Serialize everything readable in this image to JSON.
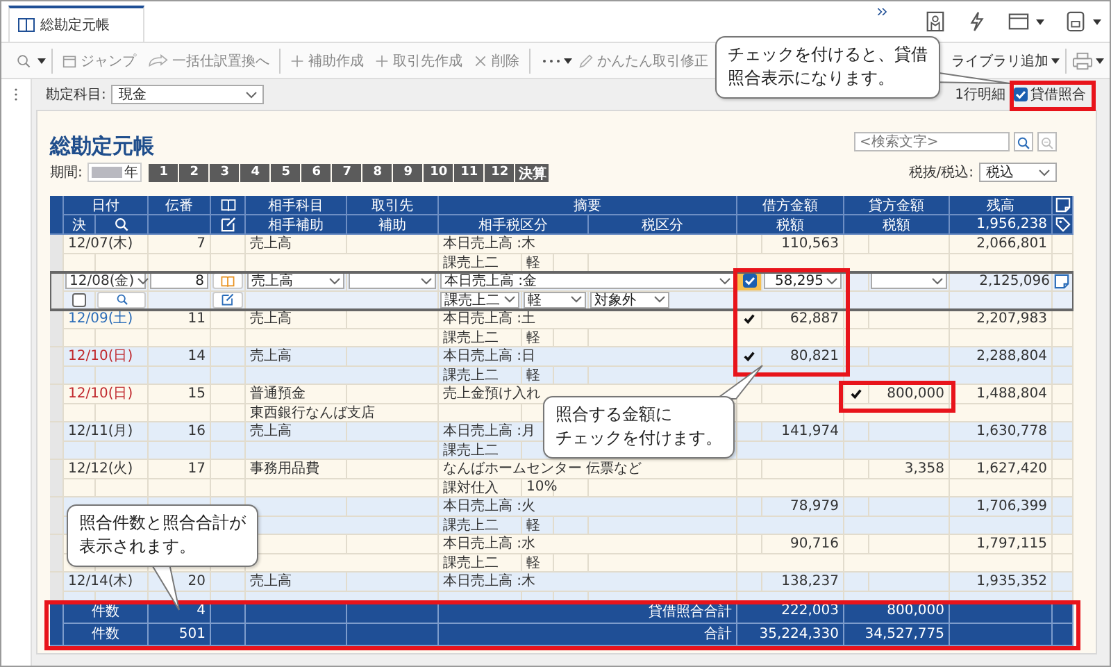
{
  "tabs": [
    {
      "label": "総勘定元帳",
      "selected": true
    }
  ],
  "toolbar": {
    "jump": "ジャンプ",
    "bulk_replace": "一括仕訳置換へ",
    "create_sub": "補助作成",
    "create_partner": "取引先作成",
    "delete": "削除",
    "quick_edit": "かんたん取引修正",
    "library_add": "ライブラリ追加"
  },
  "filter": {
    "account_label": "勘定科目:",
    "account": "現金",
    "one_line": "1行明細",
    "reconcile": {
      "label": "貸借照合",
      "checked": true
    }
  },
  "ledger": {
    "title": "総勘定元帳",
    "search_placeholder": "<検索文字>",
    "period_label": "期間:",
    "year_suffix": "年",
    "months": [
      "1",
      "2",
      "3",
      "4",
      "5",
      "6",
      "7",
      "8",
      "9",
      "10",
      "11",
      "12",
      "決算"
    ],
    "tax_label": "税抜/税込:",
    "tax_mode": "税込"
  },
  "table": {
    "header": {
      "date": "日付",
      "settled": "決",
      "number": "伝番",
      "account": "相手科目",
      "sub_account": "相手補助",
      "partner": "取引先",
      "partner_sub": "補助",
      "description": "摘要",
      "counter_tax": "相手税区分",
      "tax_class": "税区分",
      "debit": "借方金額",
      "debit_tax": "税額",
      "credit": "貸方金額",
      "credit_tax": "税額",
      "balance": "残高",
      "opening_balance": "1,956,238"
    },
    "entries": [
      {
        "kind": "view",
        "date": "12/07(木)",
        "color": "#333333",
        "number": "7",
        "account": "売上高",
        "description": "本日売上高 :木",
        "tax_class": "課売上二",
        "tax_rate": "軽",
        "debit": "110,563",
        "debit_checked": false,
        "credit_checked": false,
        "balance": "2,066,801"
      },
      {
        "kind": "edit",
        "date": "12/08(金)",
        "color": "#333333",
        "number": "8",
        "account": "売上高",
        "description": "本日売上高 :金",
        "tax_class": "課売上二",
        "tax_rate": "軽",
        "own_tax_class": "対象外",
        "debit": "58,295",
        "debit_checked": true,
        "credit_checked": false,
        "settled": false,
        "balance": "2,125,096"
      },
      {
        "kind": "view",
        "date": "12/09(土)",
        "color": "#2a6cb8",
        "number": "11",
        "account": "売上高",
        "description": "本日売上高 :土",
        "tax_class": "課売上二",
        "tax_rate": "軽",
        "debit": "62,887",
        "debit_checked": true,
        "credit_checked": false,
        "balance": "2,207,983"
      },
      {
        "kind": "view",
        "date": "12/10(日)",
        "color": "#c0282d",
        "number": "14",
        "account": "売上高",
        "description": "本日売上高 :日",
        "tax_class": "課売上二",
        "tax_rate": "軽",
        "debit": "80,821",
        "debit_checked": true,
        "credit_checked": false,
        "balance": "2,288,804"
      },
      {
        "kind": "view",
        "date": "12/10(日)",
        "color": "#c0282d",
        "number": "15",
        "account": "普通預金",
        "sub_account": "東西銀行なんば支店",
        "description": "売上金預け入れ",
        "credit": "800,000",
        "debit_checked": false,
        "credit_checked": true,
        "balance": "1,488,804"
      },
      {
        "kind": "view",
        "date": "12/11(月)",
        "color": "#333333",
        "number": "16",
        "account": "売上高",
        "description": "本日売上高 :月",
        "tax_class": "課売上二",
        "debit": "141,974",
        "debit_checked": false,
        "credit_checked": false,
        "balance": "1,630,778"
      },
      {
        "kind": "view",
        "date": "12/12(火)",
        "color": "#333333",
        "number": "17",
        "account": "事務用品費",
        "description": "なんばホームセンター 伝票など",
        "tax_class": "課対仕入",
        "tax_rate": "10%",
        "credit": "3,358",
        "debit_checked": false,
        "credit_checked": false,
        "balance": "1,627,420"
      },
      {
        "kind": "view",
        "description": "本日売上高 :火",
        "tax_class": "課売上二",
        "tax_rate": "軽",
        "debit": "78,979",
        "debit_checked": false,
        "credit_checked": false,
        "balance": "1,706,399"
      },
      {
        "kind": "view",
        "description": "本日売上高 :水",
        "tax_class": "課売上二",
        "tax_rate": "軽",
        "debit": "90,716",
        "debit_checked": false,
        "credit_checked": false,
        "balance": "1,797,115"
      },
      {
        "kind": "view",
        "date": "12/14(木)",
        "color": "#333333",
        "number": "20",
        "account": "売上高",
        "description": "本日売上高 :木",
        "debit": "138,237",
        "debit_checked": false,
        "credit_checked": false,
        "balance": "1,935,352"
      }
    ],
    "totals": [
      {
        "label": "件数",
        "count": "4",
        "total_label": "貸借照合合計",
        "debit": "222,003",
        "credit": "800,000"
      },
      {
        "label": "件数",
        "count": "501",
        "total_label": "合計",
        "debit": "35,224,330",
        "credit": "34,527,775"
      }
    ]
  },
  "callouts": [
    {
      "lines": [
        "チェックを付けると、貸借",
        "照合表示になります。"
      ]
    },
    {
      "lines": [
        "照合する金額に",
        "チェックを付けます。"
      ]
    },
    {
      "lines": [
        "照合件数と照合合計が",
        "表示されます。"
      ]
    }
  ]
}
